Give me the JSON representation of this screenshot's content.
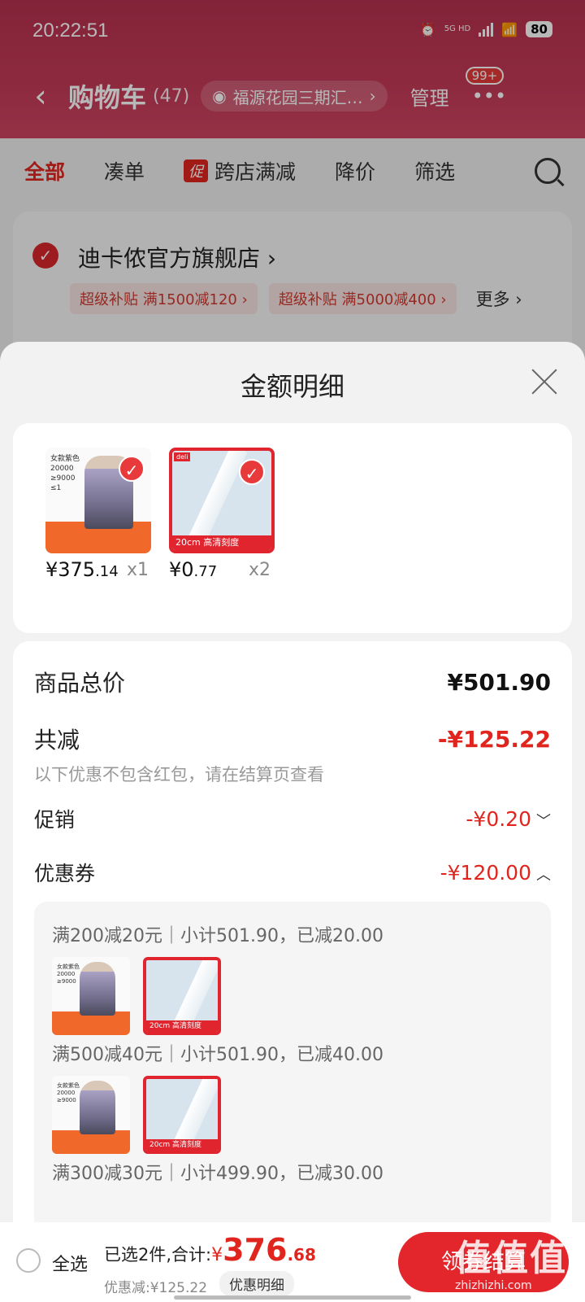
{
  "status": {
    "time": "20:22:51",
    "network": "5G HD",
    "battery": "80"
  },
  "nav": {
    "title": "购物车",
    "count": "(47)",
    "location": "福源花园三期汇…",
    "manage": "管理",
    "badge": "99+"
  },
  "filters": [
    {
      "label": "全部",
      "active": true
    },
    {
      "label": "凑单"
    },
    {
      "label": "跨店满减",
      "tag": "促"
    },
    {
      "label": "降价"
    },
    {
      "label": "筛选"
    }
  ],
  "store": {
    "name": "迪卡侬官方旗舰店",
    "coupons": [
      "超级补贴 满1500减120",
      "超级补贴 满5000减400"
    ],
    "more": "更多"
  },
  "sheet": {
    "title": "金额明细",
    "products": [
      {
        "price_int": "¥375",
        "price_dec": ".14",
        "qty": "x1",
        "image": "jacket"
      },
      {
        "price_int": "¥0",
        "price_dec": ".77",
        "qty": "x2",
        "image": "ruler"
      }
    ],
    "total_label": "商品总价",
    "total_value": "¥501.90",
    "reduce_label": "共减",
    "reduce_value": "-¥125.22",
    "note": "以下优惠不包含红包，请在结算页查看",
    "promo_label": "促销",
    "promo_value": "-¥0.20",
    "coupon_label": "优惠券",
    "coupon_value": "-¥120.00",
    "coupon_lines": [
      "满200减20元｜小计501.90，已减20.00",
      "满500减40元｜小计501.90，已减40.00",
      "满300减30元｜小计499.90，已减30.00"
    ]
  },
  "bottom": {
    "select_all": "全选",
    "summary_prefix": "已选2件,合计:",
    "total_symbol": "¥",
    "total_int": "376",
    "total_dec": ".68",
    "discount": "优惠减:¥125.22",
    "detail_btn": "优惠明细",
    "checkout": "领券结算"
  },
  "watermark": {
    "main": "值值值",
    "sub": "zhizhizhi.com"
  },
  "colors": {
    "brand_red": "#e0251e",
    "header": "#c43a57"
  }
}
